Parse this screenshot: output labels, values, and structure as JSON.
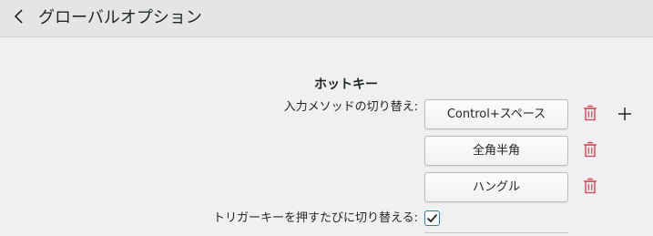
{
  "header": {
    "title": "グローバルオプション",
    "back_icon": "chevron-left-icon"
  },
  "hotkeys": {
    "heading": "ホットキー",
    "switch_im_label": "入力メソッドの切り替え:",
    "keys": [
      {
        "label": "Control+スペース",
        "remove_icon": "trash-icon"
      },
      {
        "label": "全角半角",
        "remove_icon": "trash-icon"
      },
      {
        "label": "ハングル",
        "remove_icon": "trash-icon"
      }
    ],
    "add_icon": "plus-icon",
    "trigger_label": "トリガーキーを押すたびに切り替える:",
    "trigger_checked": true
  },
  "colors": {
    "delete": "#da4453",
    "accent": "#2980b9"
  }
}
